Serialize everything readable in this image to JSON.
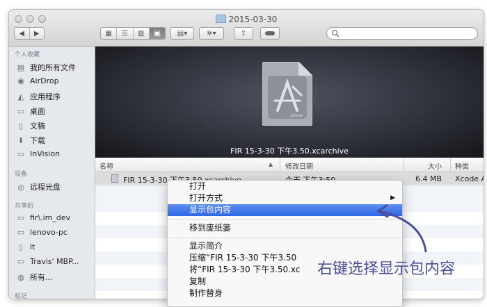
{
  "window": {
    "title": "2015-03-30"
  },
  "sidebar": {
    "favorites_header": "个人收藏",
    "favorites": [
      {
        "label": "我的所有文件",
        "icon": "all-files-icon"
      },
      {
        "label": "AirDrop",
        "icon": "airdrop-icon"
      },
      {
        "label": "应用程序",
        "icon": "applications-icon"
      },
      {
        "label": "桌面",
        "icon": "desktop-icon"
      },
      {
        "label": "文稿",
        "icon": "documents-icon"
      },
      {
        "label": "下载",
        "icon": "downloads-icon"
      },
      {
        "label": "InVision",
        "icon": "folder-icon"
      }
    ],
    "devices_header": "设备",
    "devices": [
      {
        "label": "远程光盘",
        "icon": "remote-disc-icon"
      }
    ],
    "shared_header": "共享的",
    "shared": [
      {
        "label": "fir\\.im_dev",
        "icon": "computer-icon"
      },
      {
        "label": "lenovo-pc",
        "icon": "computer-icon"
      },
      {
        "label": "lt",
        "icon": "computer-icon"
      },
      {
        "label": "Travis' MBP...",
        "icon": "computer-icon"
      },
      {
        "label": "所有...",
        "icon": "network-icon"
      }
    ],
    "tags_header": "标记"
  },
  "preview": {
    "caption": "FIR 15-3-30 下午3.50.xcarchive",
    "badge": "ARCHIVE"
  },
  "list": {
    "columns": [
      "名称",
      "修改日期",
      "大小",
      "种类"
    ],
    "file": {
      "name": "FIR 15-3-30 下午3.50.xcarchive",
      "date": "今天 下午3:50",
      "size": "6.4 MB",
      "kind": "Xcode A"
    }
  },
  "context_menu": {
    "items": [
      "打开",
      "打开方式",
      "显示包内容",
      "移到废纸篓",
      "显示简介",
      "压缩“FIR 15-3-30 下午3.50",
      "将“FIR 15-3-30 下午3.50.xc",
      "复制",
      "制作替身"
    ],
    "highlighted": "显示包内容",
    "submenu_arrow": "▶"
  },
  "annotation": {
    "text": "右键选择显示包内容",
    "color": "#4b4e9e"
  }
}
